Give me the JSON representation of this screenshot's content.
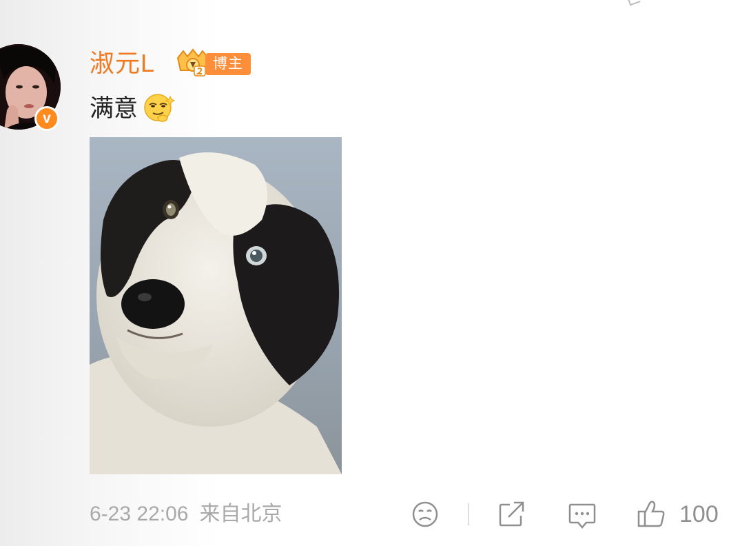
{
  "comment": {
    "author": "淑元L",
    "author_badge": "博主",
    "verified_mark": "v",
    "text": "满意",
    "emoji_name": "smug-face",
    "image_subject": "border-collie-dog-photo",
    "timestamp": "6-23 22:06",
    "source": "来自北京",
    "like_count": "100"
  },
  "colors": {
    "accent_orange": "#f07a22",
    "badge_orange": "#ff8e3a",
    "meta_gray": "#a9a9a9",
    "icon_gray": "#8f8f8f"
  },
  "icons": {
    "neutral": "neutral-face-icon",
    "share": "share-icon",
    "comment": "comment-icon",
    "like": "thumbs-up-icon",
    "crown": "crown-level-icon"
  }
}
